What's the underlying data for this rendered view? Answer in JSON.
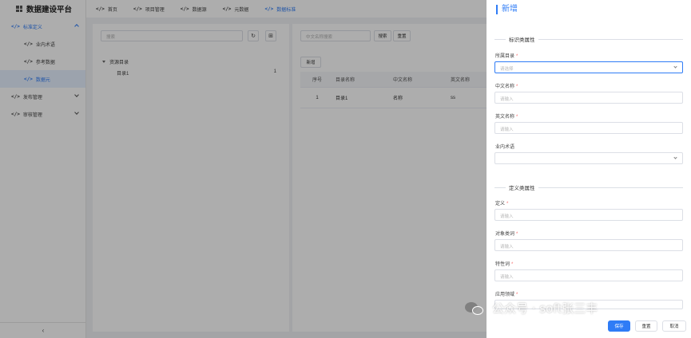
{
  "app": {
    "title": "数据建设平台"
  },
  "sidebar": {
    "items": [
      {
        "label": "标准定义",
        "expanded": true
      },
      {
        "label": "业内术语"
      },
      {
        "label": "参考数据"
      },
      {
        "label": "数据元",
        "selected": true
      },
      {
        "label": "发布管理"
      },
      {
        "label": "审核管理"
      }
    ],
    "collapse_glyph": "‹"
  },
  "topnav": {
    "tabs": [
      {
        "label": "首页"
      },
      {
        "label": "项目管理"
      },
      {
        "label": "数据源"
      },
      {
        "label": "元数据"
      },
      {
        "label": "数据标准",
        "active": true
      }
    ],
    "code_glyph": "</>"
  },
  "left_panel": {
    "search_placeholder": "搜索",
    "refresh_glyph": "↻",
    "add_glyph": "⊞",
    "tree": {
      "root_label": "资源目录",
      "children": [
        {
          "label": "目录1",
          "count": "1"
        }
      ]
    }
  },
  "right_panel": {
    "search_placeholder": "中文名称搜索",
    "search_button": "搜索",
    "reset_button": "重置",
    "add_button": "新增",
    "table": {
      "headers": [
        "序号",
        "目录名称",
        "中文名称",
        "英文名称"
      ],
      "rows": [
        [
          "1",
          "目录1",
          "名称",
          "ss"
        ]
      ]
    }
  },
  "drawer": {
    "title": "新增",
    "section1": "标识类属性",
    "section2": "定义类属性",
    "fields": [
      {
        "label": "所属目录",
        "required": true,
        "placeholder": "请选择",
        "type": "select"
      },
      {
        "label": "中文名称",
        "required": true,
        "placeholder": "请输入",
        "type": "input"
      },
      {
        "label": "英文名称",
        "required": true,
        "placeholder": "请输入",
        "type": "input"
      },
      {
        "label": "业内术语",
        "required": false,
        "placeholder": "",
        "type": "select"
      },
      {
        "label": "定义",
        "required": true,
        "placeholder": "请输入",
        "type": "input"
      },
      {
        "label": "对象类词",
        "required": true,
        "placeholder": "请输入",
        "type": "input"
      },
      {
        "label": "特性词",
        "required": true,
        "placeholder": "请输入",
        "type": "input"
      },
      {
        "label": "应用领域",
        "required": true,
        "placeholder": "",
        "type": "input"
      }
    ],
    "required_mark": "*",
    "buttons": {
      "save": "保存",
      "reset": "重置",
      "cancel": "取消"
    }
  },
  "watermark": {
    "text": "公众号 · soft张三丰"
  },
  "colors": {
    "accent": "#2f7cf6",
    "required": "#f56c6c",
    "overlay": "rgba(0,0,0,0.32)"
  }
}
